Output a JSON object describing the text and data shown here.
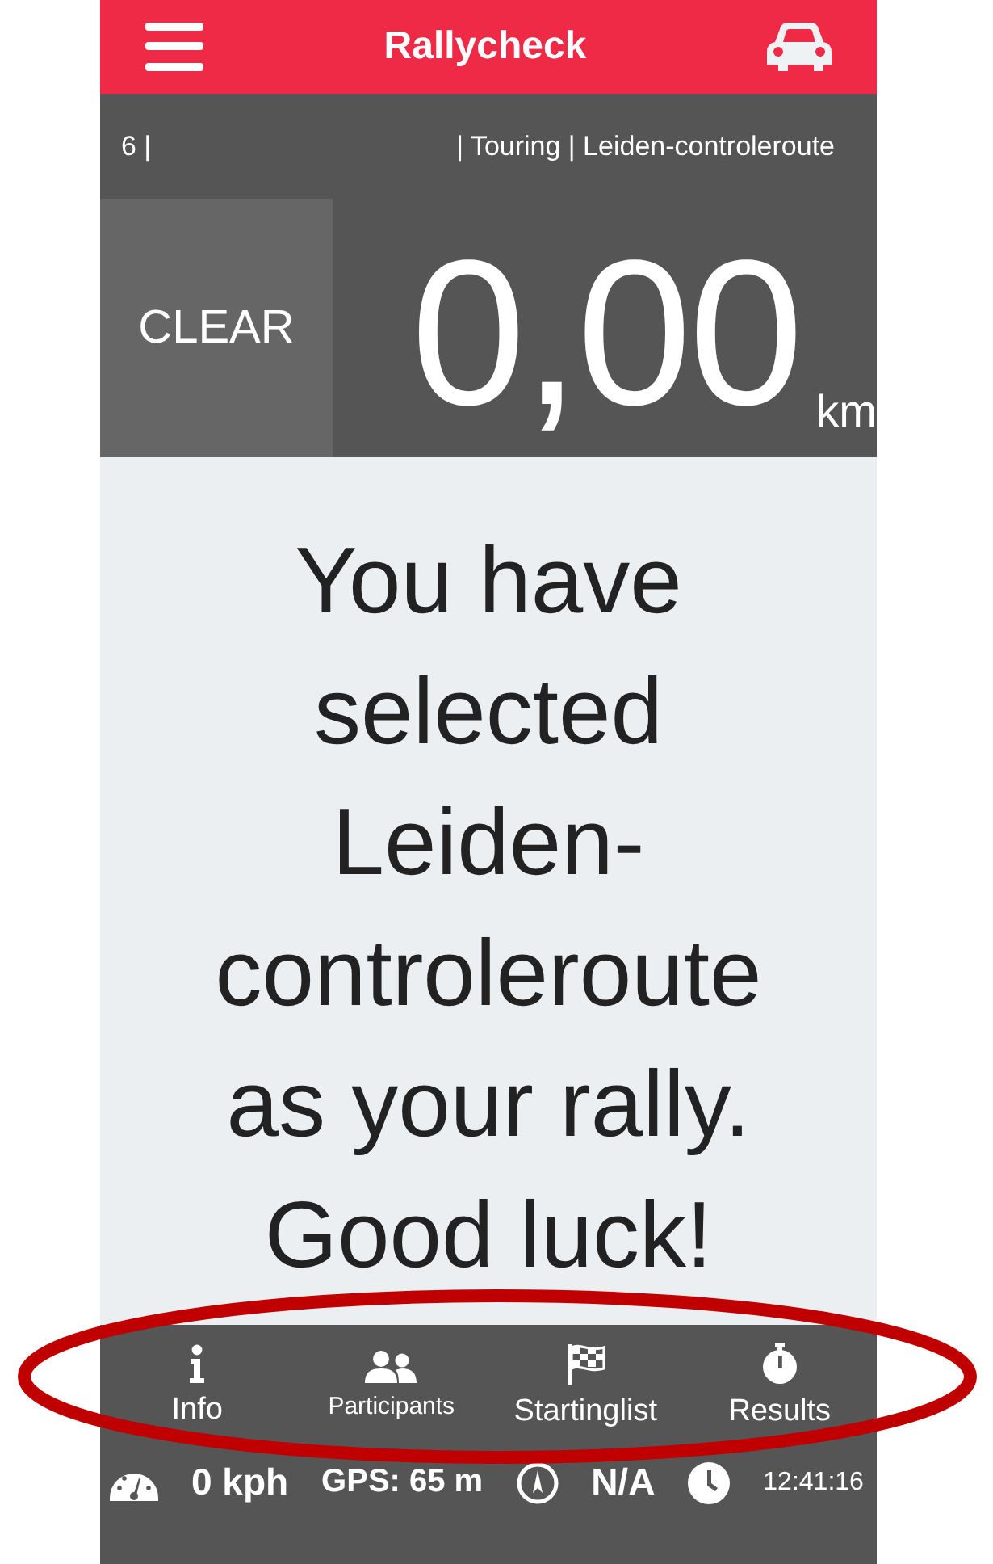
{
  "header": {
    "title": "Rallycheck"
  },
  "info_bar": {
    "left": "6 |",
    "right": "| Touring | Leiden-controleroute"
  },
  "odometer": {
    "clear_button": "CLEAR",
    "distance": "0,00",
    "unit": "km"
  },
  "message": "You have selected Leiden-controleroute as your rally. Good luck!",
  "tabs": [
    {
      "kind": "info",
      "label": "Info"
    },
    {
      "kind": "participants",
      "label": "Participants"
    },
    {
      "kind": "startinglist",
      "label": "Startinglist"
    },
    {
      "kind": "results",
      "label": "Results"
    }
  ],
  "status_bar": {
    "speed": "0 kph",
    "gps": "GPS: 65 m",
    "heading": "N/A",
    "time": "12:41:16"
  }
}
